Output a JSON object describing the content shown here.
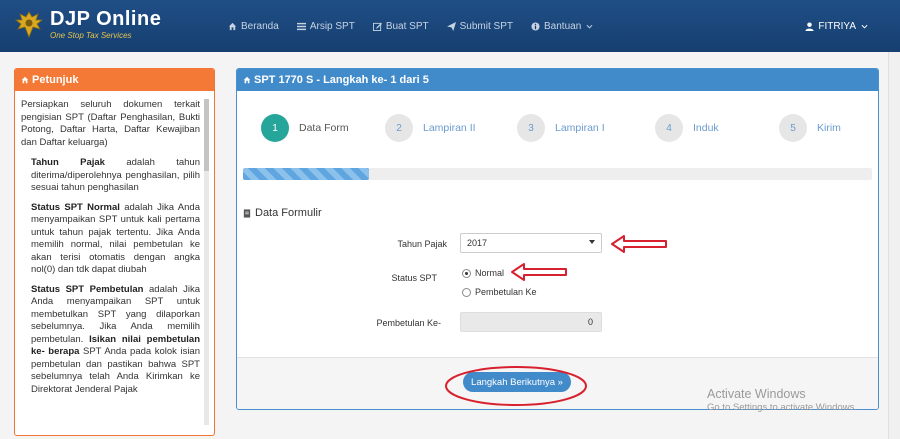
{
  "brand": {
    "title": "DJP Online",
    "subtitle": "One Stop Tax Services"
  },
  "nav": {
    "items": [
      {
        "label": "Beranda",
        "icon": "home-icon"
      },
      {
        "label": "Arsip SPT",
        "icon": "list-icon"
      },
      {
        "label": "Buat SPT",
        "icon": "edit-icon"
      },
      {
        "label": "Submit SPT",
        "icon": "send-icon"
      },
      {
        "label": "Bantuan",
        "icon": "info-icon"
      }
    ],
    "user": "FITRIYA"
  },
  "left_panel": {
    "title": "Petunjuk",
    "intro": "Persiapkan seluruh dokumen terkait pengisian SPT (Daftar Penghasilan, Bukti Potong, Daftar Harta, Daftar Kewajiban dan Daftar keluarga)",
    "items": [
      {
        "bold": "Tahun Pajak",
        "text": " adalah tahun diterima/diperolehnya penghasilan, pilih sesuai tahun penghasilan"
      },
      {
        "bold": "Status SPT Normal",
        "text": " adalah Jika Anda menyampaikan SPT untuk kali pertama untuk tahun pajak tertentu. Jika Anda memilih normal, nilai pembetulan ke akan terisi otomatis dengan angka nol(0) dan tdk dapat diubah"
      },
      {
        "bold": "Status SPT Pembetulan",
        "text": " adalah Jika Anda menyampaikan SPT untuk membetulkan SPT yang dilaporkan sebelumnya. Jika Anda memilih pembetulan. ",
        "bold2": "Isikan nilai pembetulan ke- berapa",
        "text2": " SPT Anda pada kolok isian pembetulan dan pastikan bahwa SPT sebelumnya telah Anda Kirimkan ke Direktorat Jenderal Pajak"
      }
    ]
  },
  "main_panel": {
    "title": "SPT 1770 S - Langkah ke- 1 dari 5",
    "steps": [
      {
        "num": "1",
        "label": "Data Form"
      },
      {
        "num": "2",
        "label": "Lampiran II"
      },
      {
        "num": "3",
        "label": "Lampiran I"
      },
      {
        "num": "4",
        "label": "Induk"
      },
      {
        "num": "5",
        "label": "Kirim"
      }
    ],
    "active_step": 1,
    "progress_fraction": 0.2,
    "section_title": "Data Formulir",
    "form": {
      "tahun_label": "Tahun Pajak",
      "tahun_value": "2017",
      "status_label": "Status SPT",
      "status_options": [
        "Normal",
        "Pembetulan Ke"
      ],
      "status_selected": "Normal",
      "pembetulan_label": "Pembetulan Ke-",
      "pembetulan_value": "0"
    },
    "next_button": "Langkah Berikutnya »"
  },
  "annotation_color": "#d8212e",
  "watermark": {
    "line1": "Activate Windows",
    "line2": "Go to Settings to activate Windows."
  }
}
